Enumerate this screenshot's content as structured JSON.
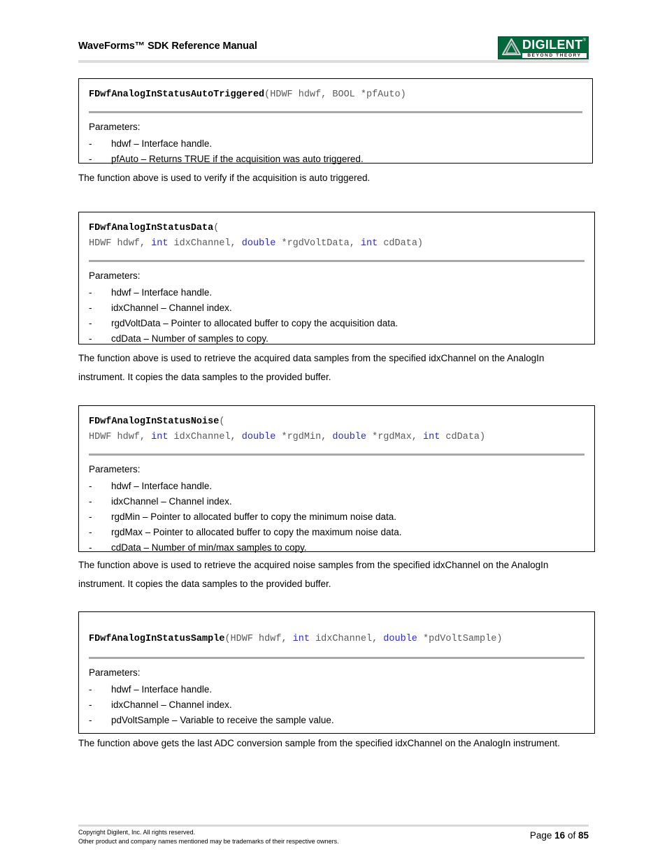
{
  "header": {
    "title": "WaveForms™ SDK Reference Manual",
    "logo": {
      "word": "DIGILENT",
      "tagline": "BEYOND THEORY",
      "tm": "®",
      "brand_color": "#00683c"
    }
  },
  "colors": {
    "keyword": "#2b2bc8",
    "code": "#595959",
    "divider": "#a8a8a8",
    "box_border": "#000000",
    "rule": "#dcdcdc"
  },
  "blocks": [
    {
      "id": "fdwf-analog-in-status-auto-triggered",
      "signature_lines": [
        [
          {
            "t": "FDwfAnalogInStatusAutoTriggered",
            "s": "fname"
          },
          {
            "t": "(HDWF hdwf, BOOL *pfAuto)",
            "s": "plain"
          }
        ]
      ],
      "params_label": "Parameters:",
      "params": [
        "hdwf – Interface handle.",
        "pfAuto – Returns TRUE if the acquisition was auto triggered."
      ],
      "description": "The function above is used to verify if the acquisition is auto triggered."
    },
    {
      "id": "fdwf-analog-in-status-data",
      "signature_lines": [
        [
          {
            "t": "FDwfAnalogInStatusData",
            "s": "fname"
          },
          {
            "t": "(",
            "s": "plain"
          }
        ],
        [
          {
            "t": "HDWF hdwf, ",
            "s": "plain"
          },
          {
            "t": "int",
            "s": "kw"
          },
          {
            "t": " idxChannel, ",
            "s": "plain"
          },
          {
            "t": "double",
            "s": "kw"
          },
          {
            "t": " *rgdVoltData, ",
            "s": "plain"
          },
          {
            "t": "int",
            "s": "kw"
          },
          {
            "t": " cdData)",
            "s": "plain"
          }
        ]
      ],
      "params_label": "Parameters:",
      "params": [
        "hdwf – Interface handle.",
        "idxChannel – Channel index.",
        "rgdVoltData – Pointer to allocated buffer to copy the acquisition data.",
        "cdData – Number of samples to copy."
      ],
      "description": "The function above is used to retrieve the acquired data samples from the specified idxChannel on the AnalogIn instrument. It copies the data samples to the provided buffer."
    },
    {
      "id": "fdwf-analog-in-status-noise",
      "signature_lines": [
        [
          {
            "t": "FDwfAnalogInStatusNoise",
            "s": "fname"
          },
          {
            "t": "(",
            "s": "plain"
          }
        ],
        [
          {
            "t": "HDWF hdwf, ",
            "s": "plain"
          },
          {
            "t": "int",
            "s": "kw"
          },
          {
            "t": " idxChannel, ",
            "s": "plain"
          },
          {
            "t": "double",
            "s": "kw"
          },
          {
            "t": " *rgdMin, ",
            "s": "plain"
          },
          {
            "t": "double",
            "s": "kw"
          },
          {
            "t": " *rgdMax, ",
            "s": "plain"
          },
          {
            "t": "int",
            "s": "kw"
          },
          {
            "t": " cdData)",
            "s": "plain"
          }
        ]
      ],
      "params_label": "Parameters:",
      "params": [
        "hdwf – Interface handle.",
        "idxChannel – Channel index.",
        "rgdMin – Pointer to allocated buffer to copy the minimum noise data.",
        "rgdMax – Pointer to allocated buffer to copy the maximum noise data.",
        "cdData – Number of min/max samples to copy."
      ],
      "description": "The function above is used to retrieve the acquired noise samples from the specified idxChannel on the AnalogIn instrument. It copies the data samples to the provided buffer."
    },
    {
      "id": "fdwf-analog-in-status-sample",
      "signature_lines": [
        [
          {
            "t": "FDwfAnalogInStatusSample",
            "s": "fname"
          },
          {
            "t": "(HDWF hdwf, ",
            "s": "plain"
          },
          {
            "t": "int",
            "s": "kw"
          },
          {
            "t": " idxChannel, ",
            "s": "plain"
          },
          {
            "t": "double",
            "s": "kw"
          },
          {
            "t": " *pdVoltSample)",
            "s": "plain"
          }
        ]
      ],
      "params_label": "Parameters:",
      "params": [
        "hdwf – Interface handle.",
        "idxChannel – Channel index.",
        "pdVoltSample – Variable to receive the sample value."
      ],
      "description": "The function above gets the last ADC conversion sample from the specified idxChannel on the AnalogIn instrument."
    }
  ],
  "footer": {
    "copyright_line1": "Copyright Digilent, Inc. All rights reserved.",
    "copyright_line2": "Other product and company names mentioned may be trademarks of their respective owners.",
    "page_prefix": "Page",
    "page_number": "16",
    "page_of": "of",
    "page_total": "85"
  }
}
